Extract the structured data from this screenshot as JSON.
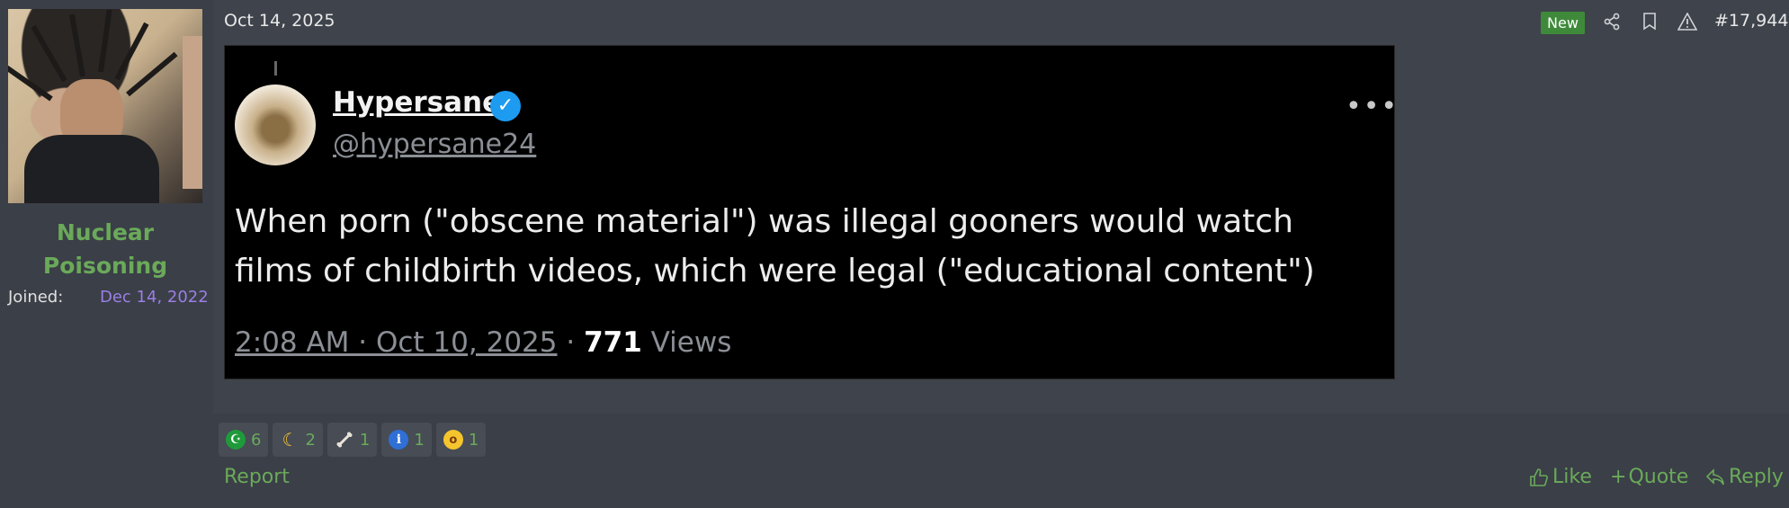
{
  "user": {
    "name": "Nuclear Poisoning",
    "joined_label": "Joined:",
    "joined_date": "Dec 14, 2022"
  },
  "post": {
    "date": "Oct 14, 2025",
    "badge": "New",
    "number": "#17,944",
    "icons": [
      "share-icon",
      "bookmark-icon",
      "warning-icon"
    ]
  },
  "tweet": {
    "display_name": "Hypersane",
    "handle": "@hypersane24",
    "more": "•••",
    "text": "When porn (\"obscene material\") was illegal gooners would watch films of childbirth videos, which were legal (\"educational content\")",
    "time": "2:08 AM · Oct 10, 2025",
    "separator": "·",
    "views_count": "771",
    "views_label": "Views"
  },
  "reactions": [
    {
      "icon": "crescent-star-icon",
      "count": "6"
    },
    {
      "icon": "moon-icon",
      "count": "2"
    },
    {
      "icon": "bone-icon",
      "count": "1"
    },
    {
      "icon": "info-icon",
      "count": "1"
    },
    {
      "icon": "yawn-icon",
      "count": "1"
    }
  ],
  "footer": {
    "report": "Report",
    "like": "Like",
    "quote": "Quote",
    "reply": "Reply"
  },
  "colors": {
    "username": "#6aaa5a",
    "joined_date": "#9b7ee6",
    "badge": "#3f8a3a",
    "background": "#3b3f47",
    "verified": "#1d9bf0"
  }
}
